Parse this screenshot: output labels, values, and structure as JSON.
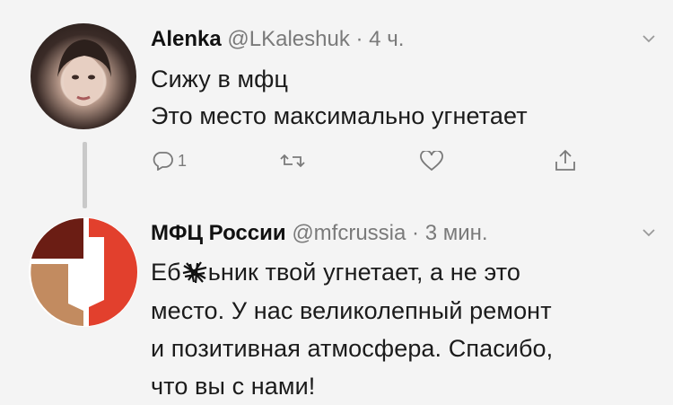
{
  "tweet1": {
    "name": "Alenka",
    "handle": "@LKaleshuk",
    "time": "4 ч.",
    "lines": [
      "Сижу в мфц",
      "Это место максимально угнетает"
    ],
    "actions": {
      "reply_count": "1"
    },
    "avatar_icon": "user-photo-avatar"
  },
  "tweet2": {
    "name": "МФЦ России",
    "handle": "@mfcrussia",
    "time": "3 мин.",
    "lines": [
      "Еб",
      "ьник твой угнетает, а не это",
      "место. У нас великолепный ремонт",
      "и позитивная атмосфера. Спасибо,",
      "что вы с нами!"
    ],
    "avatar_icon": "mfc-logo-avatar"
  },
  "colors": {
    "background": "#f4f4f4",
    "meta_text": "#7a7a7a",
    "mfc_red": "#e2402d",
    "mfc_dark": "#6b1d14",
    "mfc_tan": "#c28b60"
  }
}
